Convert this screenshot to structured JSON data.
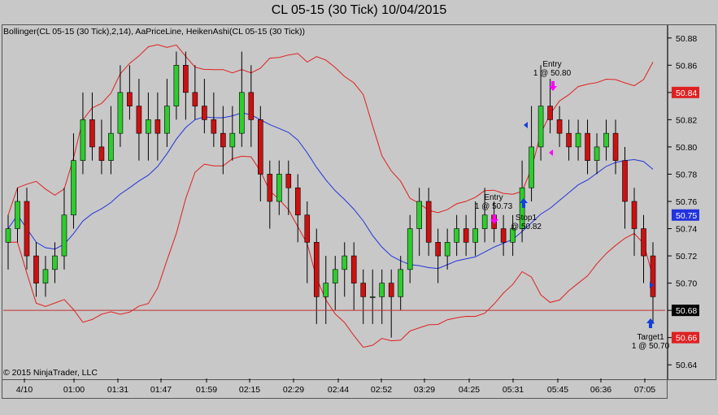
{
  "title": "CL 05-15 (30 Tick)  10/04/2015",
  "indicator_label": "Bollinger(CL 05-15 (30 Tick),2,14), AaPriceLine, HeikenAshi(CL 05-15 (30 Tick))",
  "copyright": "© 2015 NinjaTrader, LLC",
  "colors": {
    "up": "#2ecc2e",
    "down": "#cc1111",
    "boll": "#e02020",
    "mid": "#2233dd",
    "hline": "#c03030",
    "magenta": "#ff00ff",
    "arrow": "#1040e0"
  },
  "chart_data": {
    "type": "candlestick",
    "ylim": [
      50.63,
      50.89
    ],
    "y_ticks": [
      "50.88",
      "50.86",
      "50.84",
      "50.82",
      "50.80",
      "50.78",
      "50.76",
      "50.74",
      "50.72",
      "50.70",
      "50.68",
      "50.66",
      "50.64"
    ],
    "x_ticks": [
      "4/10",
      "01:00",
      "01:31",
      "01:47",
      "01:59",
      "02:15",
      "02:29",
      "02:44",
      "02:52",
      "03:29",
      "04:25",
      "05:31",
      "05:45",
      "06:36",
      "07:05"
    ],
    "price_line": 50.68,
    "price_labels": [
      {
        "text": "50.84",
        "value": 50.84,
        "color": "#e02020"
      },
      {
        "text": "50.75",
        "value": 50.75,
        "color": "#2233dd"
      },
      {
        "text": "50.68",
        "value": 50.68,
        "color": "#000000"
      },
      {
        "text": "50.66",
        "value": 50.66,
        "color": "#e02020"
      }
    ],
    "annotations": [
      {
        "text": "Entry",
        "sub": "1 @ 50.80"
      },
      {
        "text": "Entry",
        "sub": "1 @ 50.73"
      },
      {
        "text": "Stop1",
        "sub": "@ 50.82"
      },
      {
        "text": "Target1",
        "sub": "1 @ 50.70"
      }
    ],
    "candles": [
      [
        50.73,
        50.74,
        50.71,
        50.75
      ],
      [
        50.74,
        50.76,
        50.73,
        50.77
      ],
      [
        50.76,
        50.72,
        50.71,
        50.77
      ],
      [
        50.72,
        50.7,
        50.69,
        50.73
      ],
      [
        50.7,
        50.71,
        50.69,
        50.72
      ],
      [
        50.71,
        50.72,
        50.7,
        50.73
      ],
      [
        50.72,
        50.75,
        50.71,
        50.77
      ],
      [
        50.75,
        50.79,
        50.74,
        50.81
      ],
      [
        50.79,
        50.82,
        50.78,
        50.84
      ],
      [
        50.82,
        50.8,
        50.79,
        50.84
      ],
      [
        50.8,
        50.79,
        50.78,
        50.82
      ],
      [
        50.79,
        50.81,
        50.78,
        50.83
      ],
      [
        50.81,
        50.84,
        50.8,
        50.86
      ],
      [
        50.84,
        50.83,
        50.82,
        50.86
      ],
      [
        50.83,
        50.81,
        50.79,
        50.85
      ],
      [
        50.81,
        50.82,
        50.79,
        50.84
      ],
      [
        50.82,
        50.81,
        50.79,
        50.84
      ],
      [
        50.81,
        50.83,
        50.8,
        50.85
      ],
      [
        50.83,
        50.86,
        50.82,
        50.87
      ],
      [
        50.86,
        50.84,
        50.82,
        50.87
      ],
      [
        50.84,
        50.83,
        50.82,
        50.86
      ],
      [
        50.83,
        50.82,
        50.81,
        50.85
      ],
      [
        50.82,
        50.81,
        50.8,
        50.84
      ],
      [
        50.81,
        50.8,
        50.78,
        50.83
      ],
      [
        50.8,
        50.81,
        50.79,
        50.83
      ],
      [
        50.81,
        50.84,
        50.8,
        50.87
      ],
      [
        50.84,
        50.82,
        50.8,
        50.86
      ],
      [
        50.82,
        50.78,
        50.76,
        50.83
      ],
      [
        50.78,
        50.76,
        50.74,
        50.79
      ],
      [
        50.76,
        50.78,
        50.75,
        50.79
      ],
      [
        50.78,
        50.77,
        50.75,
        50.79
      ],
      [
        50.77,
        50.75,
        50.73,
        50.78
      ],
      [
        50.75,
        50.73,
        50.7,
        50.76
      ],
      [
        50.73,
        50.69,
        50.67,
        50.74
      ],
      [
        50.69,
        50.7,
        50.67,
        50.72
      ],
      [
        50.7,
        50.71,
        50.68,
        50.72
      ],
      [
        50.71,
        50.72,
        50.69,
        50.73
      ],
      [
        50.72,
        50.7,
        50.68,
        50.73
      ],
      [
        50.7,
        50.69,
        50.67,
        50.71
      ],
      [
        50.69,
        50.69,
        50.67,
        50.71
      ],
      [
        50.69,
        50.7,
        50.67,
        50.71
      ],
      [
        50.7,
        50.69,
        50.66,
        50.71
      ],
      [
        50.69,
        50.71,
        50.68,
        50.72
      ],
      [
        50.71,
        50.74,
        50.7,
        50.75
      ],
      [
        50.74,
        50.76,
        50.72,
        50.77
      ],
      [
        50.76,
        50.73,
        50.72,
        50.77
      ],
      [
        50.73,
        50.72,
        50.7,
        50.74
      ],
      [
        50.72,
        50.73,
        50.71,
        50.74
      ],
      [
        50.73,
        50.74,
        50.72,
        50.75
      ],
      [
        50.74,
        50.73,
        50.72,
        50.75
      ],
      [
        50.73,
        50.74,
        50.72,
        50.76
      ],
      [
        50.74,
        50.75,
        50.73,
        50.77
      ],
      [
        50.75,
        50.74,
        50.73,
        50.76
      ],
      [
        50.74,
        50.73,
        50.72,
        50.75
      ],
      [
        50.73,
        50.74,
        50.72,
        50.75
      ],
      [
        50.74,
        50.77,
        50.73,
        50.79
      ],
      [
        50.77,
        50.8,
        50.76,
        50.83
      ],
      [
        50.8,
        50.83,
        50.79,
        50.86
      ],
      [
        50.83,
        50.82,
        50.81,
        50.85
      ],
      [
        50.82,
        50.81,
        50.8,
        50.83
      ],
      [
        50.81,
        50.8,
        50.79,
        50.82
      ],
      [
        50.8,
        50.81,
        50.79,
        50.82
      ],
      [
        50.81,
        50.79,
        50.78,
        50.82
      ],
      [
        50.79,
        50.8,
        50.78,
        50.81
      ],
      [
        50.8,
        50.81,
        50.79,
        50.82
      ],
      [
        50.81,
        50.79,
        50.78,
        50.82
      ],
      [
        50.79,
        50.76,
        50.74,
        50.8
      ],
      [
        50.76,
        50.74,
        50.72,
        50.77
      ],
      [
        50.74,
        50.72,
        50.7,
        50.75
      ],
      [
        50.72,
        50.69,
        50.67,
        50.73
      ]
    ]
  }
}
